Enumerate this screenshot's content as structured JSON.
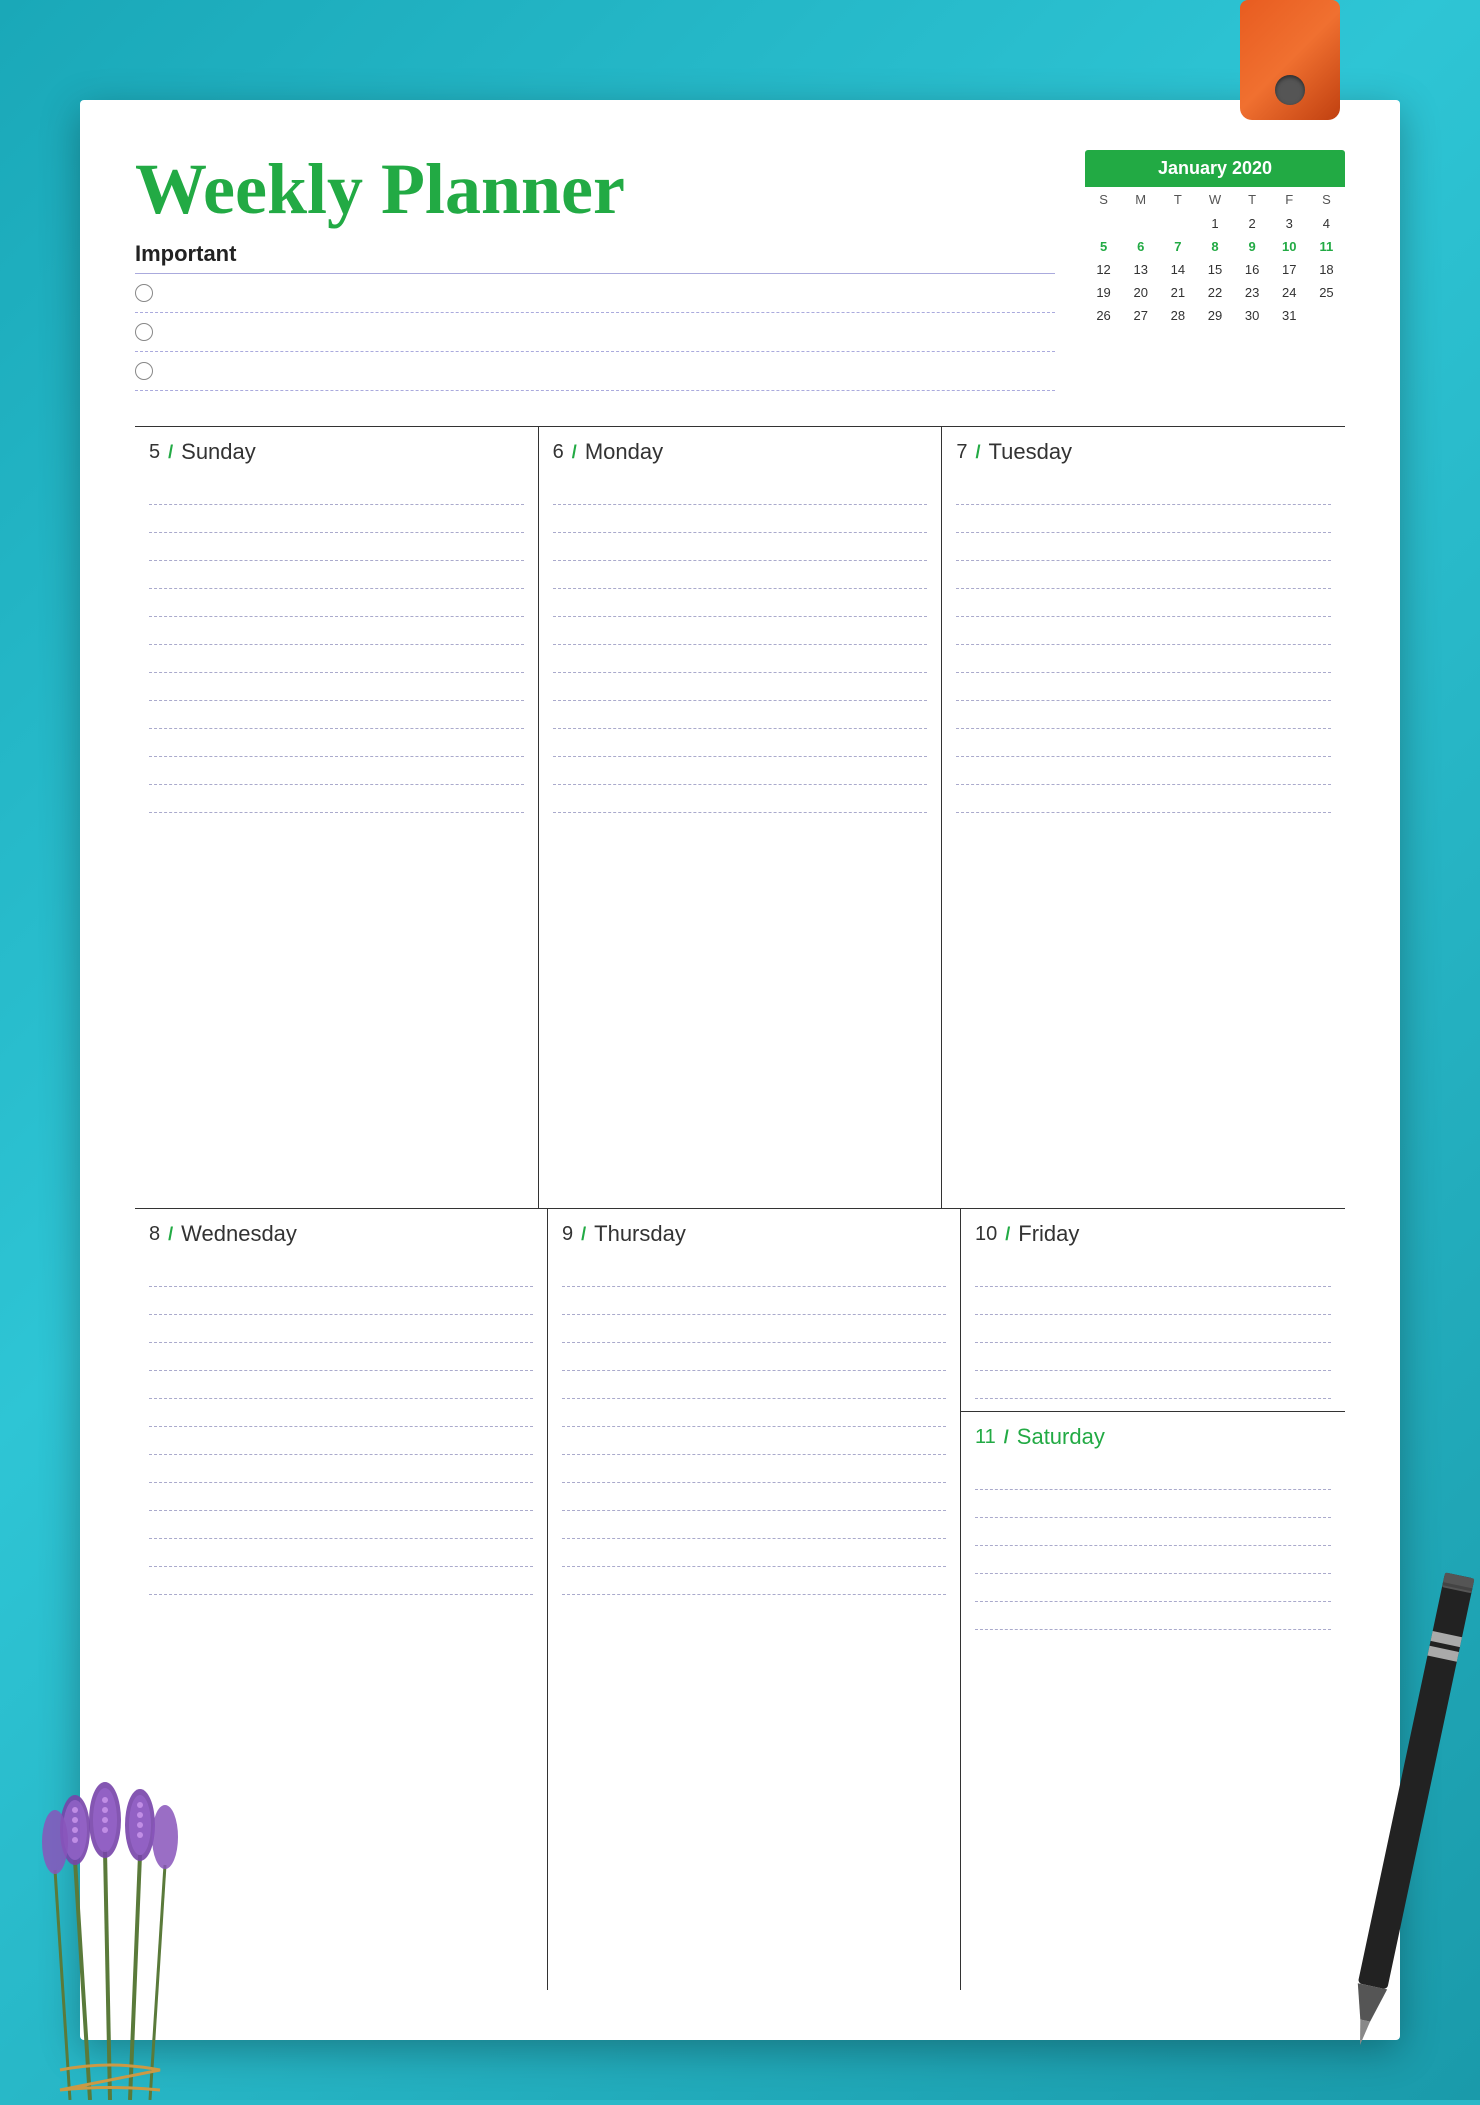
{
  "background_color": "#2ab8c8",
  "planner": {
    "title": "Weekly Planner",
    "important_label": "Important",
    "calendar": {
      "month_year": "January 2020",
      "days_of_week": [
        "S",
        "M",
        "T",
        "W",
        "T",
        "F",
        "S"
      ],
      "weeks": [
        [
          "",
          "",
          "",
          "1",
          "2",
          "3",
          "4"
        ],
        [
          "5",
          "6",
          "7",
          "8",
          "9",
          "10",
          "11"
        ],
        [
          "12",
          "13",
          "14",
          "15",
          "16",
          "17",
          "18"
        ],
        [
          "19",
          "20",
          "21",
          "22",
          "23",
          "24",
          "25"
        ],
        [
          "26",
          "27",
          "28",
          "29",
          "30",
          "31",
          ""
        ]
      ]
    },
    "days_row1": [
      {
        "number": "5",
        "name": "Sunday",
        "green": false
      },
      {
        "number": "6",
        "name": "Monday",
        "green": false
      },
      {
        "number": "7",
        "name": "Tuesday",
        "green": false
      }
    ],
    "days_row2_left": [
      {
        "number": "8",
        "name": "Wednesday",
        "green": false
      },
      {
        "number": "9",
        "name": "Thursday",
        "green": false
      }
    ],
    "days_row2_right_top": {
      "number": "10",
      "name": "Friday",
      "green": false
    },
    "days_row2_right_bottom": {
      "number": "11",
      "name": "Saturday",
      "green": true
    },
    "line_count_top": 14,
    "line_count_bottom": 12,
    "line_count_friday": 6,
    "line_count_saturday": 7
  }
}
